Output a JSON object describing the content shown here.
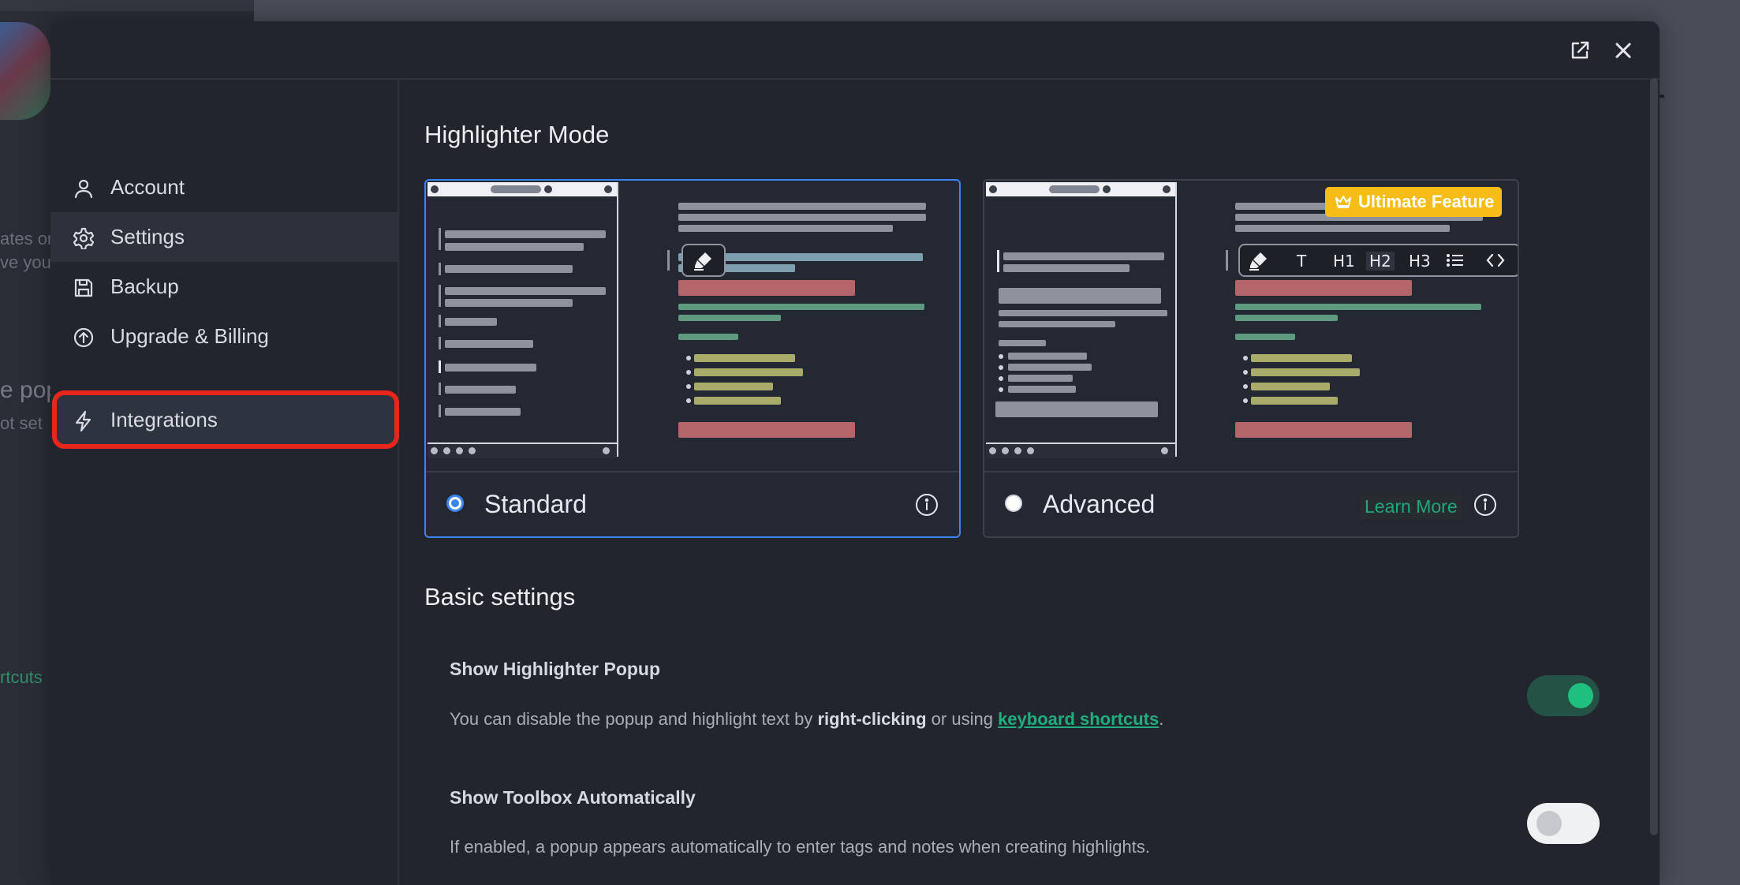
{
  "background": {
    "text_1": "ates or",
    "text_2": "ve you",
    "text_3": "e pop",
    "text_4": "ot set",
    "text_5": "rtcuts"
  },
  "modal": {
    "open_external_icon": "external-link-icon",
    "close_icon": "close-icon"
  },
  "sidebar": {
    "items": [
      {
        "label": "Account",
        "icon": "user-icon"
      },
      {
        "label": "Settings",
        "icon": "gear-icon"
      },
      {
        "label": "Backup",
        "icon": "save-icon"
      },
      {
        "label": "Upgrade & Billing",
        "icon": "upload-circle-icon"
      },
      {
        "label": "Integrations",
        "icon": "lightning-icon"
      }
    ],
    "active_index": 1,
    "highlighted_index": 4
  },
  "highlighter_mode": {
    "title": "Highlighter Mode",
    "options": [
      {
        "label": "Standard",
        "selected": true
      },
      {
        "label": "Advanced",
        "selected": false,
        "link": "Learn More",
        "badge": "Ultimate Feature"
      }
    ],
    "toolbar_buttons": [
      "T",
      "H1",
      "H2",
      "H3"
    ]
  },
  "basic_settings": {
    "title": "Basic settings",
    "items": [
      {
        "title": "Show Highlighter Popup",
        "desc_prefix": "You can disable the popup and highlight text by ",
        "desc_bold": "right-clicking",
        "desc_middle": " or using ",
        "desc_link": "keyboard shortcuts",
        "desc_suffix": ".",
        "enabled": true
      },
      {
        "title": "Show Toolbox Automatically",
        "desc": "If enabled, a popup appears automatically to enter tags and notes when creating highlights.",
        "enabled": false
      }
    ]
  },
  "colors": {
    "accent_blue": "#3a86f0",
    "accent_green": "#1fc07f",
    "badge_yellow": "#f6bd16",
    "annotation_red": "#e8261c"
  }
}
